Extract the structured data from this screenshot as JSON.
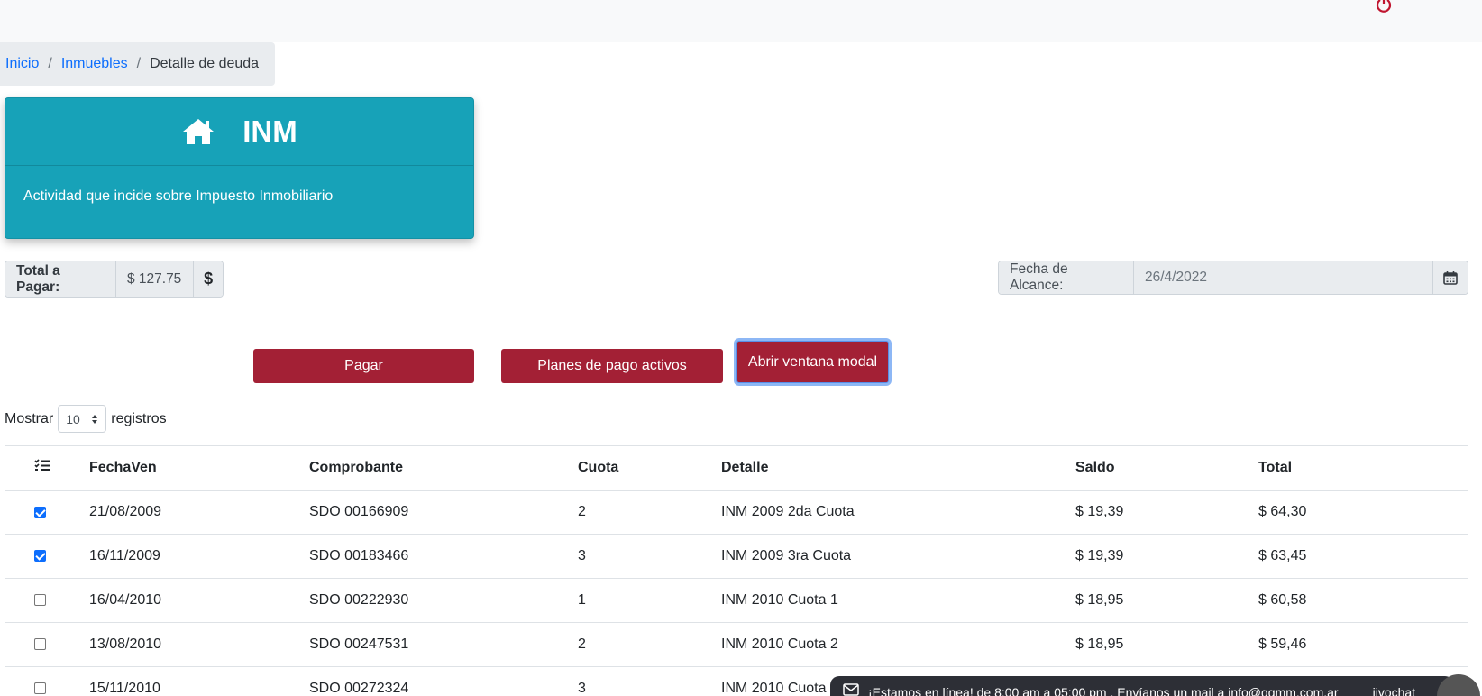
{
  "breadcrumb": {
    "home": "Inicio",
    "section": "Inmuebles",
    "current": "Detalle de deuda",
    "separator": "/"
  },
  "card": {
    "title": "INM",
    "description": "Actividad que incide sobre Impuesto Inmobiliario",
    "icon": "home-icon",
    "color": "#17a2b8"
  },
  "total": {
    "label": "Total a Pagar:",
    "value": "$ 127.75",
    "icon_text": "$"
  },
  "fecha": {
    "label": "Fecha de Alcance:",
    "value": "26/4/2022",
    "icon": "calendar-icon"
  },
  "buttons": {
    "pagar": "Pagar",
    "planes": "Planes de pago activos",
    "modal": "Abrir ventana modal",
    "color": "#a32035"
  },
  "length_menu": {
    "prefix": "Mostrar",
    "value": "10",
    "suffix": "registros"
  },
  "table": {
    "columns": [
      "FechaVen",
      "Comprobante",
      "Cuota",
      "Detalle",
      "Saldo",
      "Total"
    ],
    "rows": [
      {
        "checked": true,
        "cells": [
          "21/08/2009",
          "SDO 00166909",
          "2",
          "INM 2009 2da Cuota",
          "$ 19,39",
          "$ 64,30"
        ]
      },
      {
        "checked": true,
        "cells": [
          "16/11/2009",
          "SDO 00183466",
          "3",
          "INM 2009 3ra Cuota",
          "$ 19,39",
          "$ 63,45"
        ]
      },
      {
        "checked": false,
        "cells": [
          "16/04/2010",
          "SDO 00222930",
          "1",
          "INM 2010 Cuota 1",
          "$ 18,95",
          "$ 60,58"
        ]
      },
      {
        "checked": false,
        "cells": [
          "13/08/2010",
          "SDO 00247531",
          "2",
          "INM 2010 Cuota 2",
          "$ 18,95",
          "$ 59,46"
        ]
      },
      {
        "checked": false,
        "cells": [
          "15/11/2010",
          "SDO 00272324",
          "3",
          "INM 2010 Cuota",
          "",
          ""
        ]
      }
    ]
  },
  "chat": {
    "text": "¡Estamos en línea! de 8:00 am a 05:00 pm . Envíanos un mail a info@ggmm.com.ar",
    "brand": "jivochat",
    "icon": "envelope-icon"
  }
}
